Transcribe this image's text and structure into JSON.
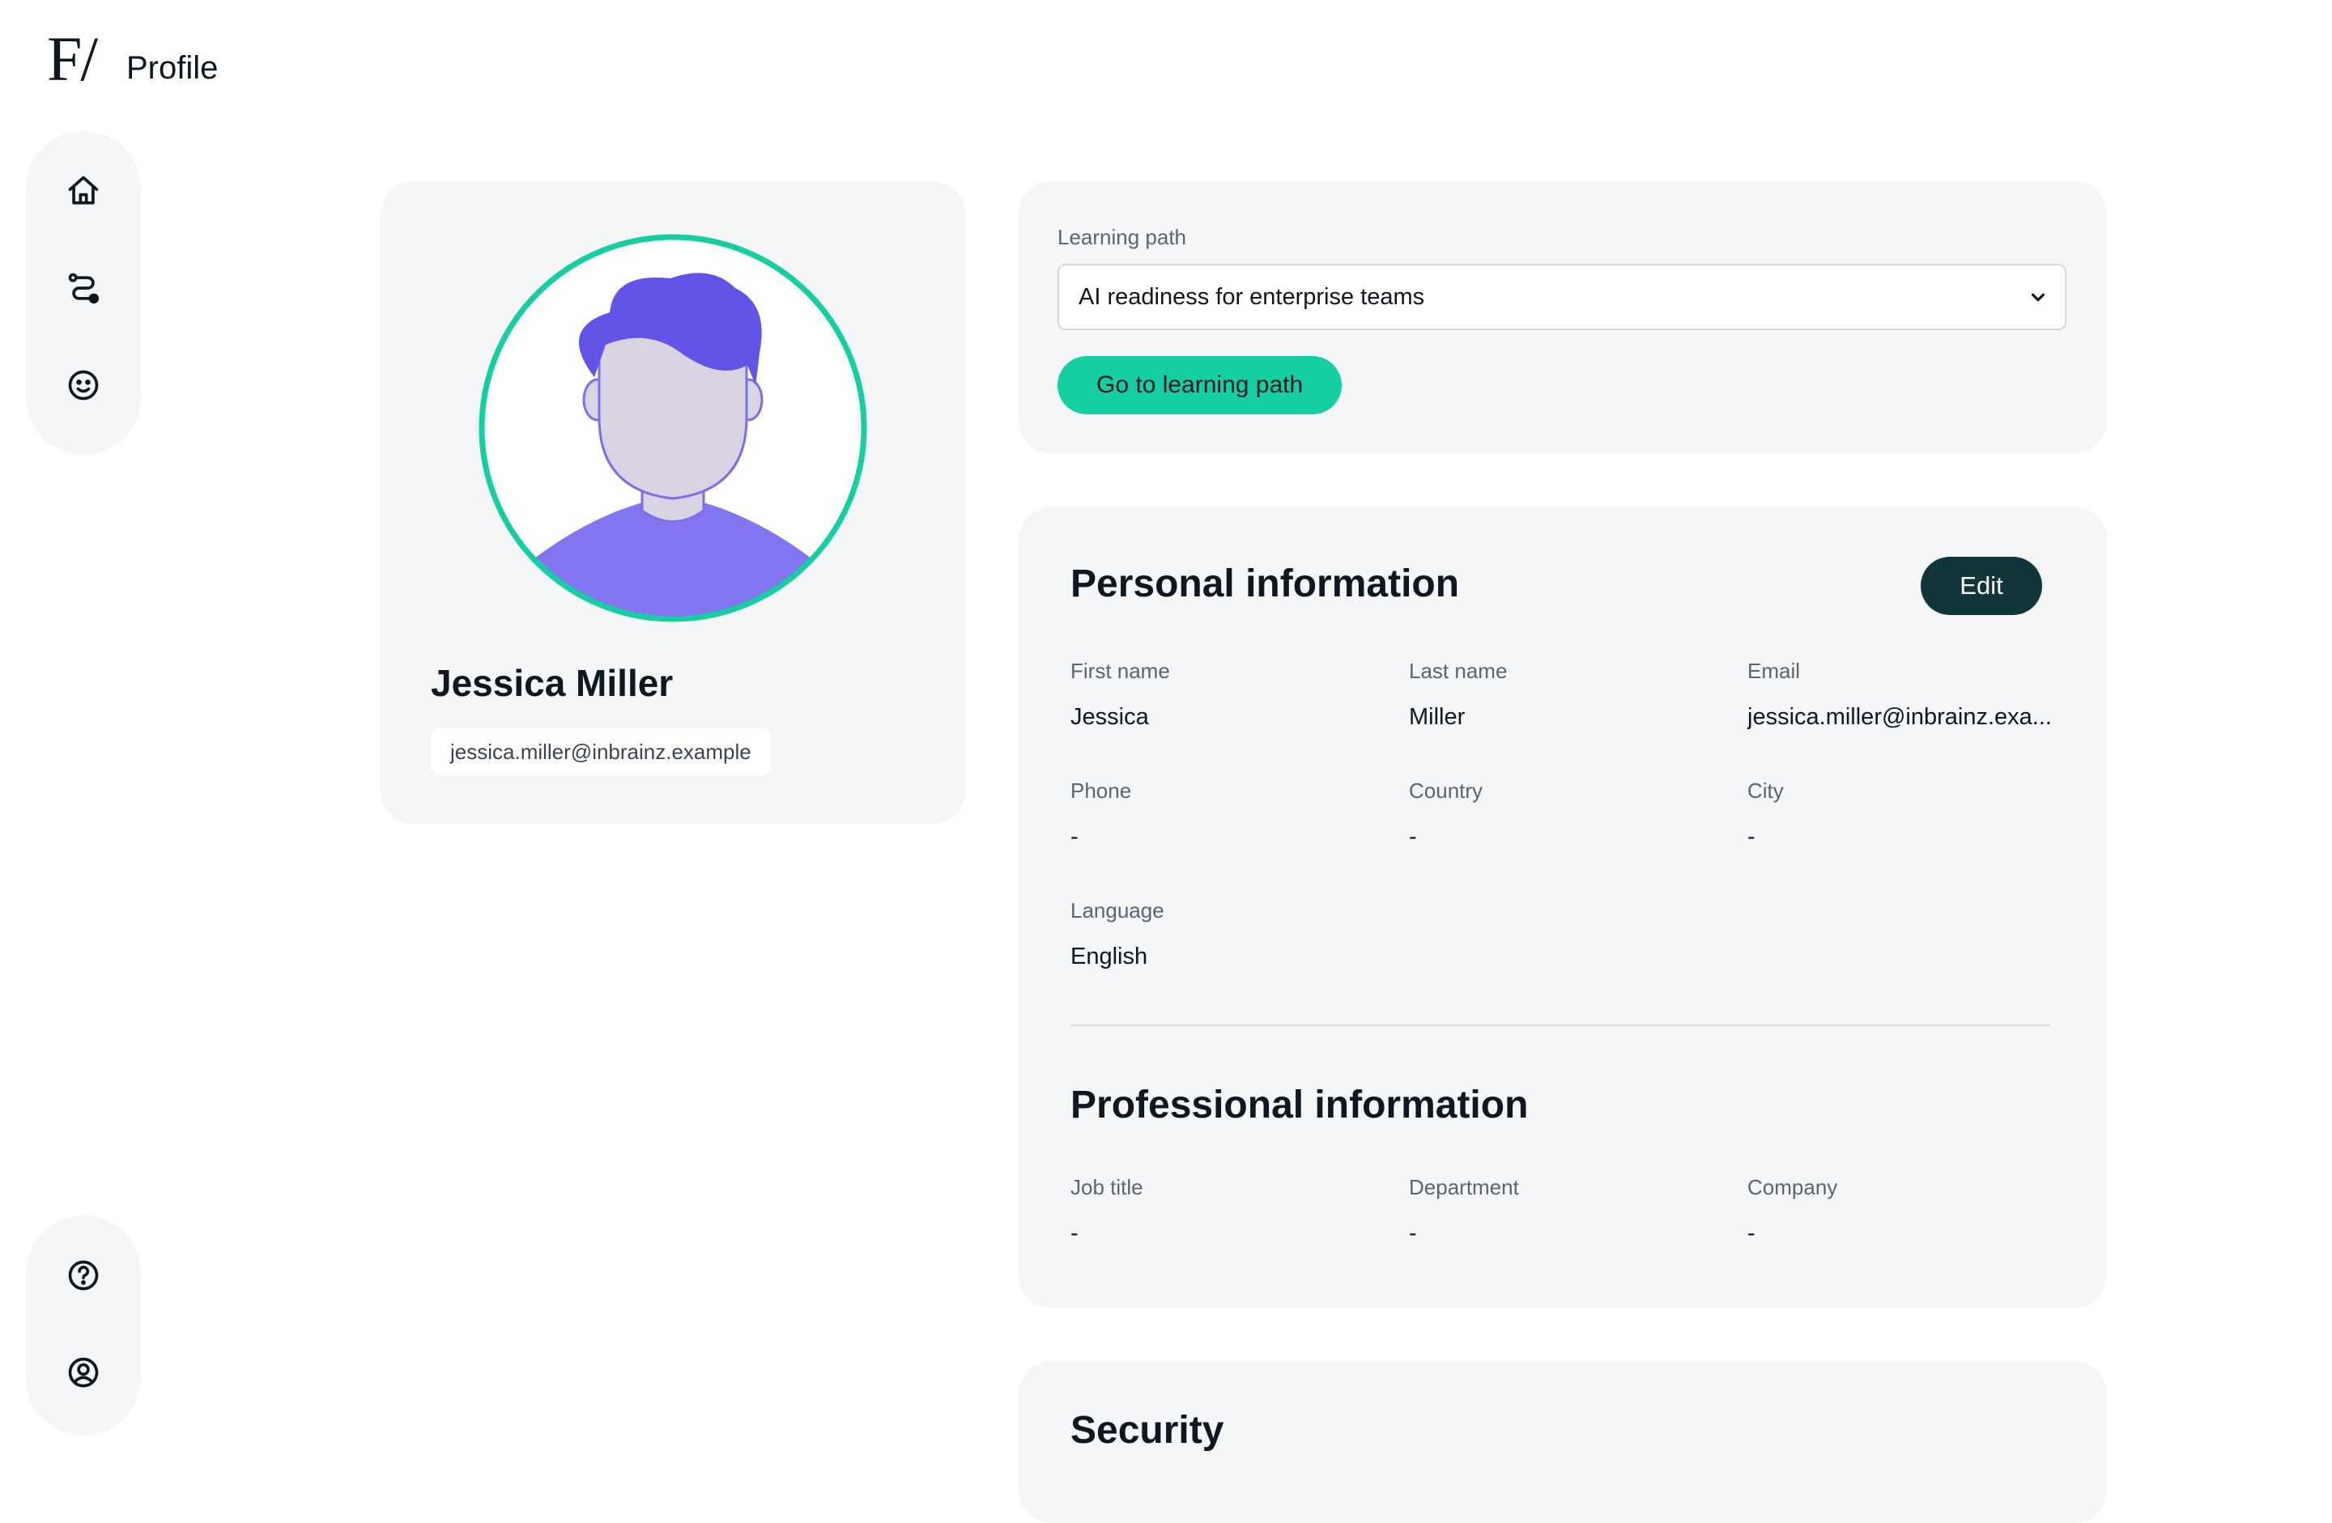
{
  "header": {
    "logo_text": "F/",
    "title": "Profile"
  },
  "sidebar": {
    "top_items": [
      {
        "icon": "home-icon"
      },
      {
        "icon": "learning-path-icon"
      },
      {
        "icon": "smiley-icon"
      }
    ],
    "bottom_items": [
      {
        "icon": "help-icon"
      },
      {
        "icon": "account-icon"
      }
    ]
  },
  "profile": {
    "name": "Jessica Miller",
    "email": "jessica.miller@inbrainz.example"
  },
  "learning_path": {
    "label": "Learning path",
    "selected": "AI readiness for enterprise teams",
    "button": "Go to learning path"
  },
  "personal": {
    "title": "Personal information",
    "edit_label": "Edit",
    "fields": [
      {
        "label": "First name",
        "value": "Jessica"
      },
      {
        "label": "Last name",
        "value": "Miller"
      },
      {
        "label": "Email",
        "value": "jessica.miller@inbrainz.exa..."
      },
      {
        "label": "Phone",
        "value": "-"
      },
      {
        "label": "Country",
        "value": "-"
      },
      {
        "label": "City",
        "value": "-"
      },
      {
        "label": "Language",
        "value": "English"
      }
    ]
  },
  "professional": {
    "title": "Professional information",
    "fields": [
      {
        "label": "Job title",
        "value": "-"
      },
      {
        "label": "Department",
        "value": "-"
      },
      {
        "label": "Company",
        "value": "-"
      }
    ]
  },
  "security": {
    "title": "Security"
  },
  "colors": {
    "accent": "#14cfa2",
    "dark_button": "#12353a",
    "card_bg": "#f4f6f8",
    "avatar_hair": "#6354e8",
    "avatar_shirt": "#8276f0",
    "avatar_skin": "#d9d3e4"
  }
}
